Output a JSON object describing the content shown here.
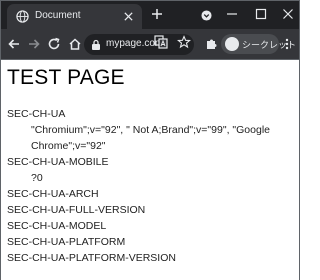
{
  "browser": {
    "tab_title": "Document",
    "url": "mypage.com",
    "profile_label": "シークレット",
    "colors": {
      "frame": "#202124",
      "toolbar": "#35363a",
      "text": "#e8eaed"
    }
  },
  "page": {
    "title": "TEST PAGE",
    "hints": [
      {
        "name": "SEC-CH-UA",
        "value": "\"Chromium\";v=\"92\", \" Not A;Brand\";v=\"99\", \"Google Chrome\";v=\"92\""
      },
      {
        "name": "SEC-CH-UA-MOBILE",
        "value": "?0"
      },
      {
        "name": "SEC-CH-UA-ARCH",
        "value": ""
      },
      {
        "name": "SEC-CH-UA-FULL-VERSION",
        "value": ""
      },
      {
        "name": "SEC-CH-UA-MODEL",
        "value": ""
      },
      {
        "name": "SEC-CH-UA-PLATFORM",
        "value": ""
      },
      {
        "name": "SEC-CH-UA-PLATFORM-VERSION",
        "value": ""
      }
    ]
  }
}
